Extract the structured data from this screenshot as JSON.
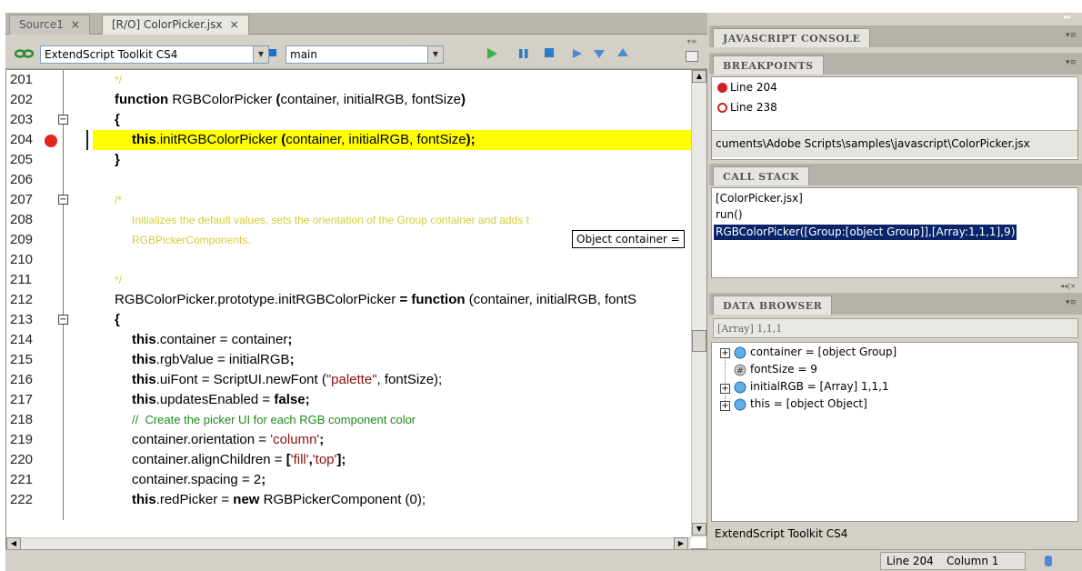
{
  "tabs": [
    {
      "label": "Source1",
      "close": "×"
    },
    {
      "label": "[R/O] ColorPicker.jsx",
      "close": "×"
    }
  ],
  "toolbar": {
    "target_app": "ExtendScript Toolkit CS4",
    "engine": "main",
    "icons": [
      "link-icon",
      "play-icon",
      "pause-icon",
      "stop-icon",
      "step-over-icon",
      "step-into-icon",
      "step-out-icon",
      "panel-menu-icon"
    ]
  },
  "editor": {
    "line_numbers": [
      "201",
      "202",
      "203",
      "204",
      "205",
      "206",
      "207",
      "208",
      "209",
      "210",
      "211",
      "212",
      "213",
      "214",
      "215",
      "216",
      "217",
      "218",
      "219",
      "220",
      "221",
      "222"
    ],
    "breakpoint_line": "204",
    "highlight_color": "#ffff00",
    "lines": {
      "l201": "*/",
      "l202a": "function",
      "l202b": " RGBColorPicker ",
      "l202c": "(",
      "l202d": "container, initialRGB, fontSize",
      "l202e": ")",
      "l203": "{",
      "l204a": "this",
      "l204b": ".initRGBColorPicker ",
      "l204c": "(",
      "l204d": "container, initialRGB, fontSize",
      "l204e": ");",
      "l205": "}",
      "l207": "/*",
      "l208": "Initializes the default values, sets the orientation of the Group container and adds t",
      "l209": "RGBPickerComponents.",
      "l211": "*/",
      "l212a": "RGBColorPicker.prototype.initRGBColorPicker ",
      "l212b": "= ",
      "l212c": "function",
      "l212d": " (container, initialRGB, fontS",
      "l213": "{",
      "l214a": "this",
      "l214b": ".container = container",
      "l214c": ";",
      "l215a": "this",
      "l215b": ".rgbValue = initialRGB",
      "l215c": ";",
      "l216a": "this",
      "l216b": ".uiFont = ScriptUI.newFont (",
      "l216c": "\"palette\"",
      "l216d": ", fontSize);",
      "l217a": "this",
      "l217b": ".updatesEnabled = ",
      "l217c": "false",
      "l217d": ";",
      "l218": "//  Create the picker UI for each RGB component color",
      "l219a": "container.orientation = ",
      "l219b": "'column'",
      "l219c": ";",
      "l220a": "container.alignChildren = ",
      "l220b": "[",
      "l220c": "'fill'",
      "l220d": ",",
      "l220e": "'top'",
      "l220f": "];",
      "l221a": "container.spacing = 2",
      "l221b": ";",
      "l222a": "this",
      "l222b": ".redPicker = ",
      "l222c": "new",
      "l222d": " RGBPickerComponent (0);"
    },
    "tooltip": "Object container ="
  },
  "panels": {
    "console": {
      "title": "JAVASCRIPT CONSOLE"
    },
    "breakpoints": {
      "title": "BREAKPOINTS",
      "items": [
        {
          "label": "Line 204",
          "icon": "breakpoint-enabled-icon",
          "color": "#cc2222"
        },
        {
          "label": "Line 238",
          "icon": "breakpoint-disabled-icon",
          "color": "#cc2222"
        }
      ],
      "path": "cuments\\Adobe Scripts\\samples\\javascript\\ColorPicker.jsx"
    },
    "callstack": {
      "title": "CALL STACK",
      "items": [
        "[ColorPicker.jsx]",
        "run()",
        "RGBColorPicker([Group:[object Group]],[Array:1,1,1],9)"
      ]
    },
    "databrowser": {
      "title": "DATA BROWSER",
      "filter": "[Array] 1,1,1",
      "items": [
        {
          "label": "container = [object Group]",
          "icon": "object-icon"
        },
        {
          "label": "fontSize = 9",
          "icon": "number-icon"
        },
        {
          "label": "initialRGB = [Array] 1,1,1",
          "icon": "object-icon"
        },
        {
          "label": "this = [object Object]",
          "icon": "object-icon"
        }
      ],
      "footer": "ExtendScript Toolkit CS4"
    }
  },
  "status": {
    "line": "Line 204",
    "column": "Column 1"
  }
}
